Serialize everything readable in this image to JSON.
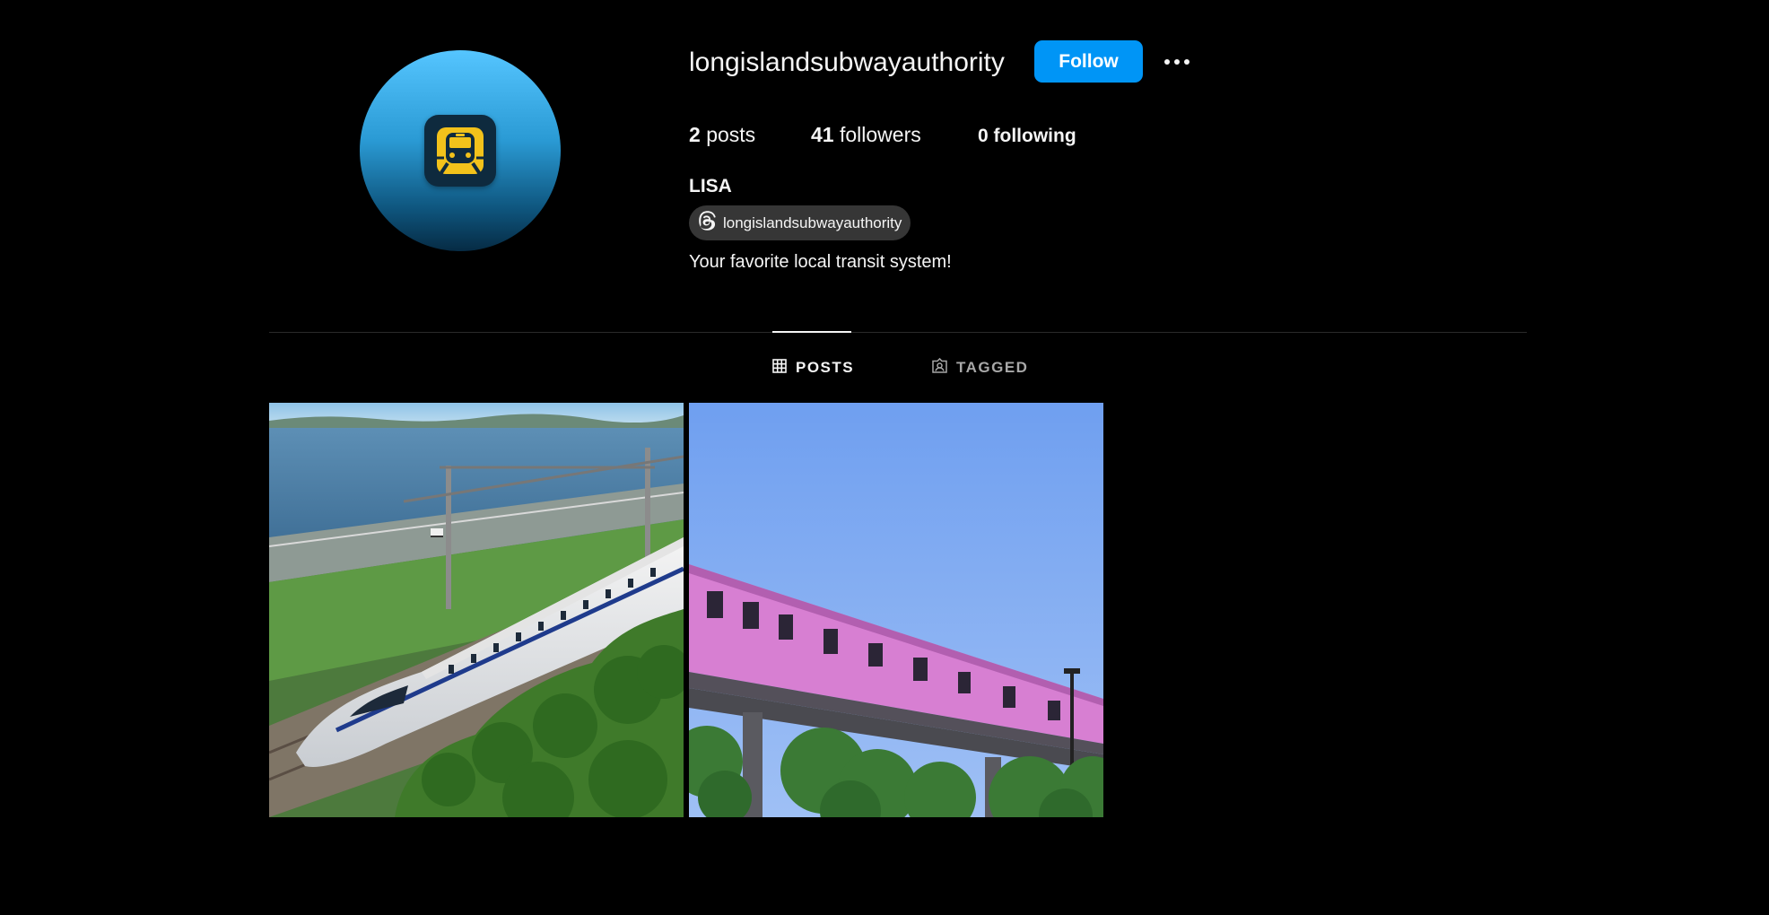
{
  "profile": {
    "username": "longislandsubwayauthority",
    "display_name": "LISA",
    "threads_handle": "longislandsubwayauthority",
    "bio": "Your favorite local transit system!",
    "avatar_icon": "train-icon"
  },
  "actions": {
    "follow_label": "Follow",
    "more_icon": "more-options-icon"
  },
  "stats": {
    "posts_count": "2",
    "posts_label": "posts",
    "followers_count": "41",
    "followers_label": "followers",
    "following_count": "0",
    "following_label": "following"
  },
  "tabs": [
    {
      "label": "POSTS",
      "icon": "grid-icon",
      "active": true
    },
    {
      "label": "TAGGED",
      "icon": "tagged-icon",
      "active": false
    }
  ],
  "posts": [
    {
      "icon": "photo-bullet-train-coast"
    },
    {
      "icon": "photo-pink-elevated-train"
    }
  ],
  "colors": {
    "accent": "#0095f6",
    "background": "#000000",
    "chip": "#363636",
    "text": "#f5f5f5",
    "muted": "#a8a8a8"
  }
}
